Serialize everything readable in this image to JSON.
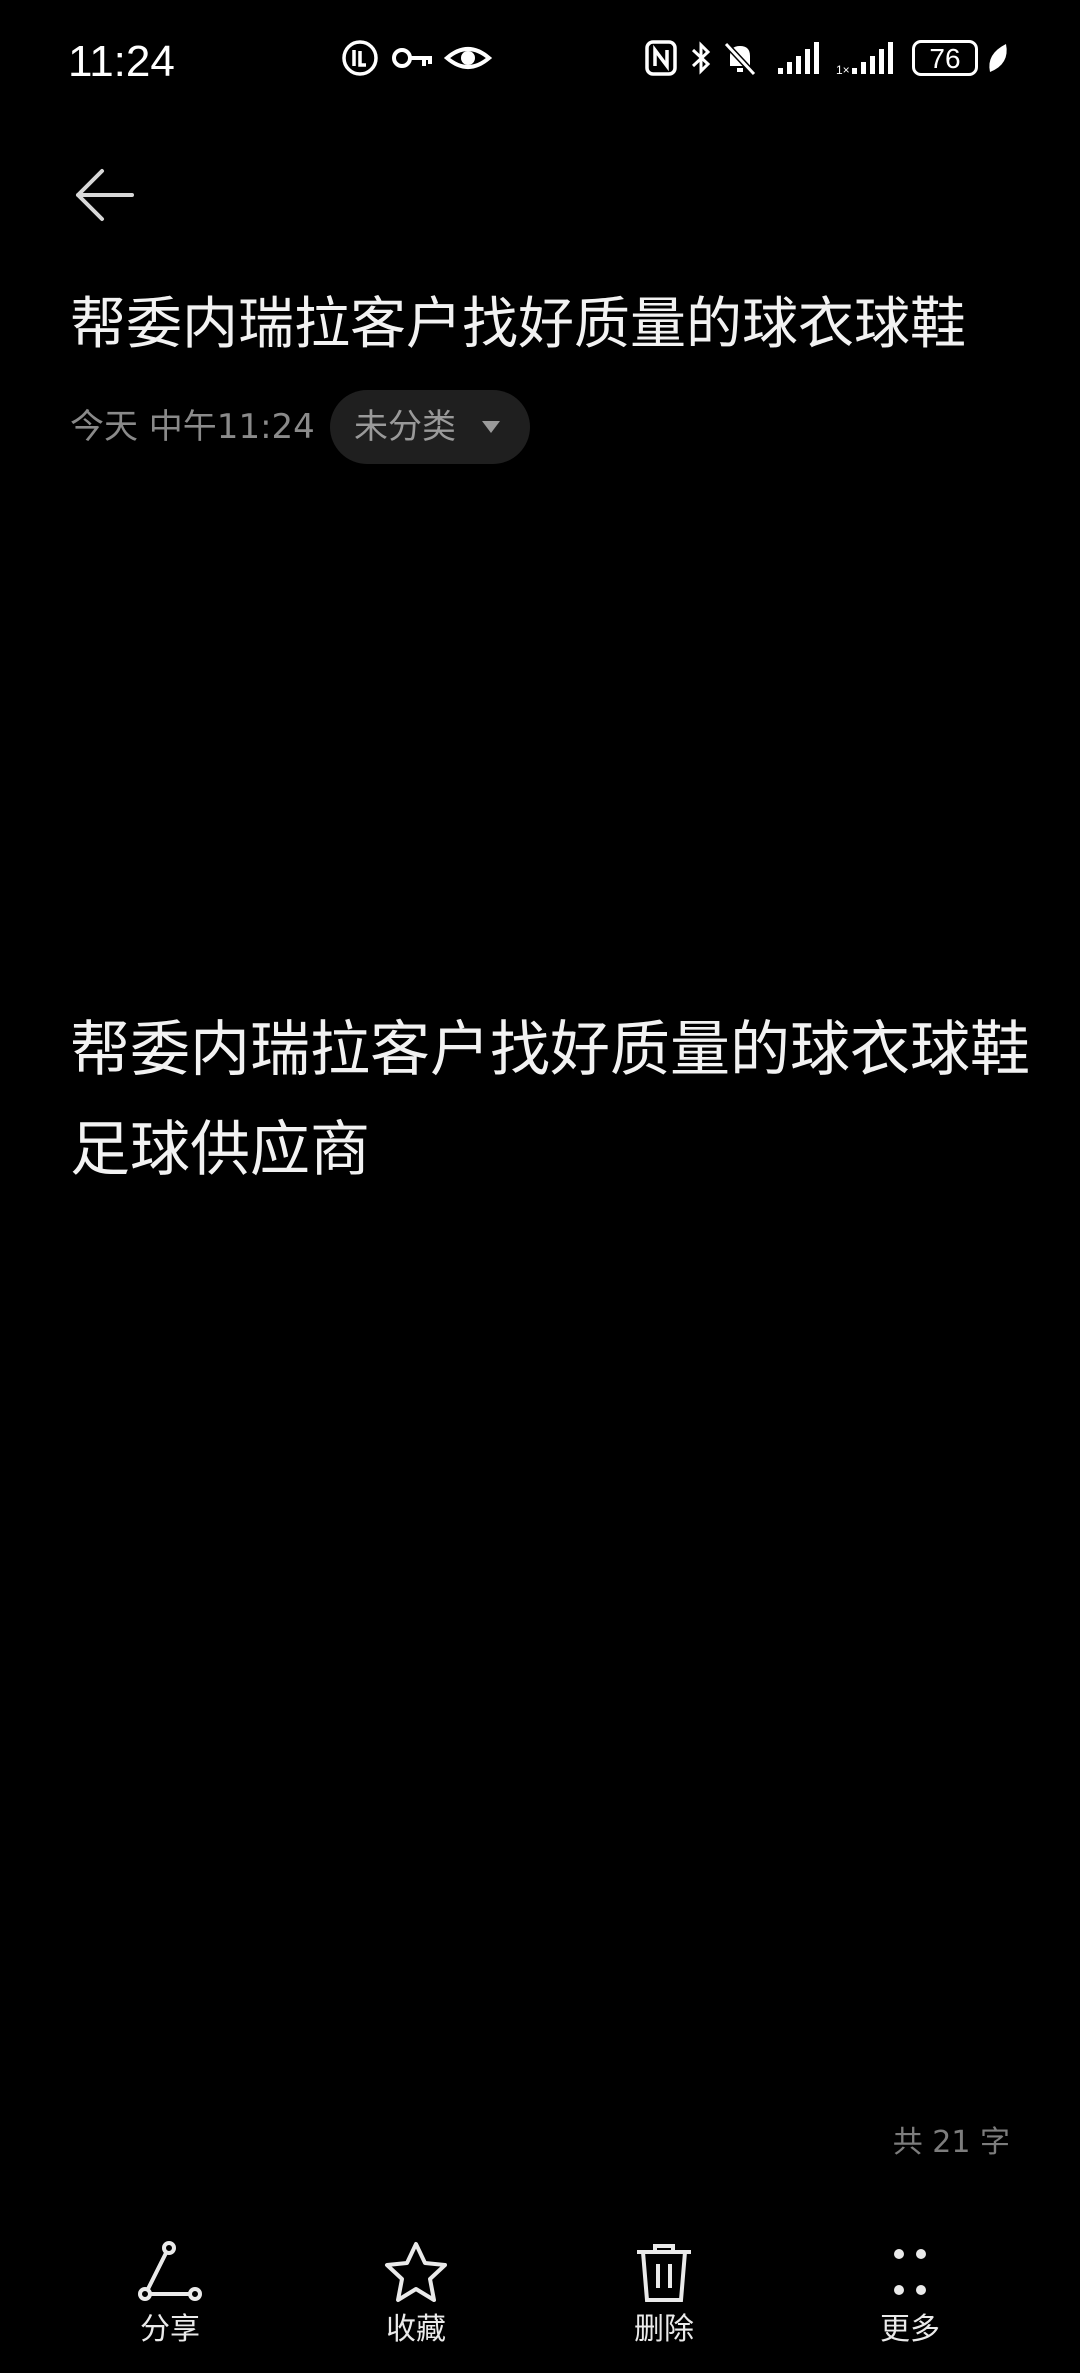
{
  "status_bar": {
    "time": "11:24",
    "battery": "76",
    "icons": [
      "app-badge-icon",
      "key-icon",
      "eye-icon",
      "nfc-icon",
      "bluetooth-icon",
      "bell-off-icon",
      "signal-icon",
      "signal-icon",
      "battery-icon",
      "leaf-icon"
    ]
  },
  "header": {
    "back_icon": "arrow-left-icon",
    "title": "帮委内瑞拉客户找好质量的球衣球鞋",
    "date": "今天 中午11:24",
    "category": "未分类"
  },
  "note": {
    "body": "帮委内瑞拉客户找好质量的球衣球鞋足球供应商"
  },
  "footer": {
    "word_count": "共 21 字"
  },
  "toolbar": {
    "share_label": "分享",
    "favorite_label": "收藏",
    "delete_label": "删除",
    "more_label": "更多"
  }
}
